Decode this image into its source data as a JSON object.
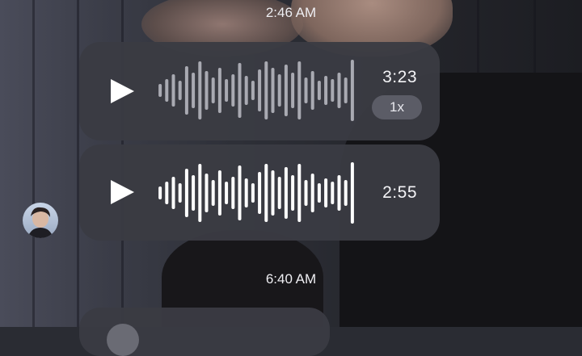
{
  "chat": {
    "timestamps": [
      "2:46 AM",
      "6:40 AM"
    ],
    "messages": [
      {
        "type": "voice",
        "duration": "3:23",
        "speed": "1x",
        "played": true,
        "waveform_color": "#a9aab2"
      },
      {
        "type": "voice",
        "duration": "2:55",
        "played": false,
        "waveform_color": "#ffffff"
      }
    ]
  },
  "icons": {
    "play": "play-icon",
    "avatar": "contact-avatar"
  },
  "colors": {
    "bubble": "#3a3b43",
    "text": "#f4f4f7",
    "speed_pill": "#5b5c66"
  }
}
